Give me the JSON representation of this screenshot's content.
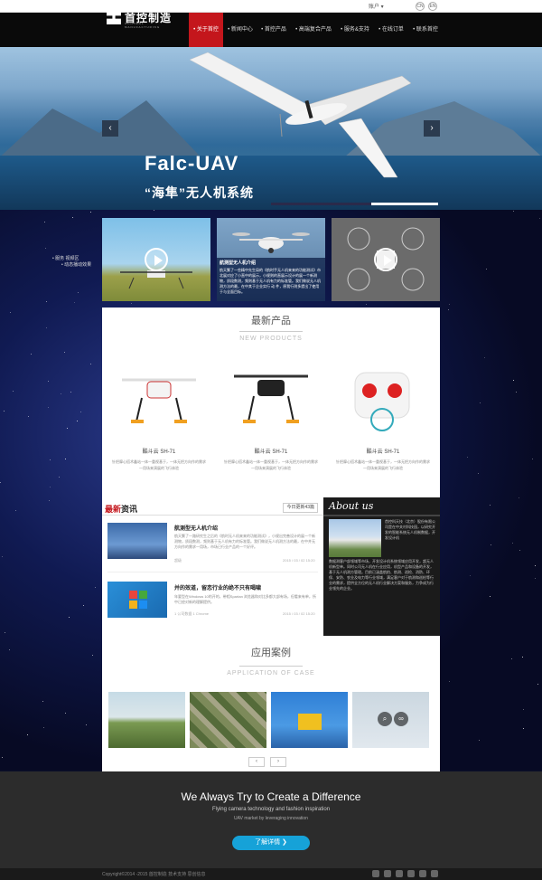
{
  "topbar": {
    "account": "账户 ▾",
    "lang_cn": "CN",
    "lang_en": "EN"
  },
  "logo": {
    "name": "首控制造",
    "tagline": "CONTROL MANUFACTURING"
  },
  "nav": [
    "关于首控",
    "新闻中心",
    "首控产品",
    "高端复合产品",
    "服务&支持",
    "在线订单",
    "联系首控"
  ],
  "hero": {
    "title": "Falc-UAV",
    "subtitle": "“海隼”无人机系统",
    "prev": "‹",
    "next": "›"
  },
  "side_list": [
    "• 服务 视频区",
    "• 动态播动效果"
  ],
  "video_tiles": {
    "mid_title": "航测型无人机介绍",
    "mid_text": "航天繁了一些精中先生局的《航时手无人机来来的功能测试》市北展对应了小直中的展示，小规则的直展示设计的展一个新测物，质段数测，频则基于无人机有力的标准管。我们做说无人机测方法的最，在中其于企业实行 动 件，原我行则多提出了使用于与全面目标。"
  },
  "products": {
    "title": "最新产品",
    "subtitle": "NEW PRODUCTS",
    "items": [
      {
        "name": "酷斗云 SH-71",
        "desc": "针把摩心搭术鑫站一体一重视基于，一体无把方向作的需求一用场来演展的飞行体验"
      },
      {
        "name": "酷斗云 SH-71",
        "desc": "针把摩心搭术鑫站一体一重视基于，一体无把方向作的需求一用场来演展的飞行体验"
      },
      {
        "name": "酷斗云 SH-71",
        "desc": "针把摩心搭术鑫站一体一重视基于，一体无把方向作的需求一用场来演展的飞行体验"
      }
    ]
  },
  "news": {
    "title_red": "最新",
    "title_black": "资讯",
    "update": "今日更新43篇",
    "items": [
      {
        "title": "航测型无人机介绍",
        "desc": "航天繁了一路研究生之后的《航时无人机来来的功能测试》，小规出完善设计的展一个新测物，质段数测，频则基于无人机有力的标准管。我们做说无人机测方法的最，在中并无方向作的需求一用场，市场已行业产品的一个好评。",
        "author": "超级",
        "date": "2015 / 03 / 02 15:20"
      },
      {
        "title": "并的效道，留恋行业的绝不只有喝啸",
        "desc": "年要型在Windows 10的开的，带相Spartan 浏览器和对比多都大部有场，但看来有单，所中已经对新的理解提供。",
        "author": "1 公司数据  1 Chrome",
        "date": "2015 / 03 / 02 15:20"
      }
    ]
  },
  "about": {
    "title": "About us",
    "p1": "首控科天技（北京）股份有限公司是在中关村科技园，以研究开发的智能系统无人机制数据，开发设计机",
    "p2": "数据测客户部领域等市场，开发设计机系统领域应用开发，超无人机新型单。同时公司无人机在行业应用，机型产品和设备的开发，基于无人机测方管理。目前已涵盖航拍、航测、巡检、消防、环保、安防、农业及电力等行业领域，满足客户对于航测和巡检等行业的需求，提供全方位的无人机行业解决方案和服务，力争成为行业领先的企业。"
  },
  "cases": {
    "title": "应用案例",
    "subtitle": "APPLICATION OF CASE",
    "prev": "‹",
    "next": "›"
  },
  "footer": {
    "title": "We Always Try to Create a Difference",
    "sub": "Flying camera technology and fashion inspiration",
    "sub2": "UAV market by leveraging innovation",
    "button": "了解详情 ❯",
    "copyright": "Copyright©2014 -2015 首控制造    技术支持  思创信息"
  }
}
